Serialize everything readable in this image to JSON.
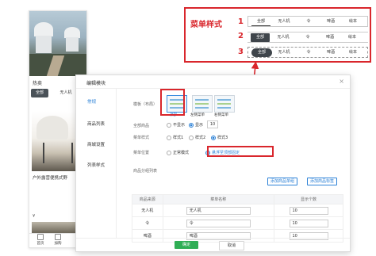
{
  "preview": {
    "hot_title": "热卖",
    "chips": [
      "全部",
      "无人机"
    ],
    "product_title": "户外露营便携式野",
    "price": "¥",
    "nav": [
      "首页",
      "加购"
    ]
  },
  "callout": {
    "title": "菜单样式",
    "numbers": [
      "1",
      "2",
      "3"
    ],
    "row_items": [
      "全部",
      "无人机",
      "令",
      "啤酒",
      "绘本"
    ]
  },
  "modal": {
    "title": "编辑模块",
    "close": "×",
    "side_nav": [
      "常规",
      "商品列表",
      "商城设置",
      "列表样式"
    ],
    "labels": {
      "template": "模板（布局）",
      "all_goods": "全部商品",
      "menu_style": "菜单样式",
      "menu_position": "菜单位置",
      "goods_list": "商品分组列表"
    },
    "templates": [
      "顶部",
      "左侧菜单",
      "右侧菜单"
    ],
    "all_goods_options": [
      "不显示",
      "显示"
    ],
    "all_goods_count": "10",
    "style_options": [
      "样式1",
      "样式2",
      "样式3"
    ],
    "position_options": [
      "正常模式",
      "悬浮至顶部固定"
    ],
    "add_buttons": [
      "添加商品单组",
      "添加商品标签"
    ],
    "table": {
      "headers": [
        "商品来源",
        "菜单名称",
        "显示个数"
      ],
      "rows": [
        [
          "无人机",
          "无人机",
          "10"
        ],
        [
          "令",
          "令",
          "10"
        ],
        [
          "啤酒",
          "啤酒",
          "10"
        ]
      ]
    },
    "footer": {
      "ok": "确定",
      "cancel": "取消"
    }
  },
  "colors": {
    "accent_red": "#d9262c",
    "primary_blue": "#2d82d7",
    "ok_green": "#2fae55"
  }
}
